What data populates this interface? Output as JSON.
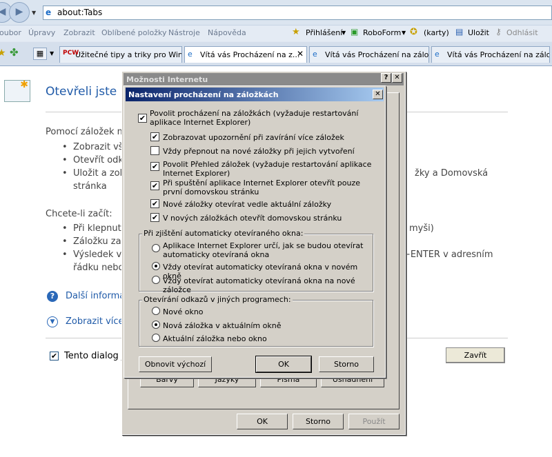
{
  "browser": {
    "address": "about:Tabs",
    "menu": [
      "oubor",
      "Úpravy",
      "Zobrazit",
      "Oblíbené položky",
      "Nástroje",
      "Nápověda"
    ],
    "toolbar": {
      "login": "Přihlášení",
      "roboform": "RoboForm",
      "cards": "(karty)",
      "save": "Uložit",
      "logout": "Odhlásit"
    },
    "tabs": [
      {
        "label": "Užitečné tipy a triky pro Win..."
      },
      {
        "label": "Vítá vás Procházení na z..."
      },
      {
        "label": "Vítá vás Procházení na zálož..."
      },
      {
        "label": "Vítá vás Procházení na zálož..."
      }
    ]
  },
  "page": {
    "heading": "Otevřeli jste n",
    "intro": "Pomocí záložek m",
    "bullets1": [
      "Zobrazit vš",
      "Otevřít odk",
      "Uložit a zob",
      "stránka"
    ],
    "bullets1_right": "žky a Domovská",
    "subheading": "Chcete-li začít:",
    "bullets2": [
      "Při klepnutí",
      "Záložku zav",
      "Výsledek vy",
      "řádku nebo"
    ],
    "bullets2_right_a": "myši)",
    "bullets2_right_b": "T+ENTER v adresním",
    "more_info": "Další informa",
    "show_more": "Zobrazit více",
    "dont_show": "Tento dialog j",
    "close_btn": "Zavřít"
  },
  "internet_options": {
    "title": "Možnosti Internetu",
    "buttons_row": [
      "Barvy",
      "Jazyky",
      "Písma",
      "Usnadnění"
    ],
    "ok": "OK",
    "cancel": "Storno",
    "apply": "Použít"
  },
  "tabbed_settings": {
    "title": "Nastavení procházení na záložkách",
    "enable": {
      "label": "Povolit procházení na záložkách (vyžaduje restartování aplikace Internet Explorer)",
      "checked": true
    },
    "options": [
      {
        "label": "Zobrazovat upozornění při zavírání více záložek",
        "checked": true
      },
      {
        "label": "Vždy přepnout na nové záložky při jejich vytvoření",
        "checked": false
      },
      {
        "label": "Povolit Přehled záložek (vyžaduje restartování aplikace Internet Explorer)",
        "checked": true
      },
      {
        "label": "Při spuštění aplikace Internet Explorer otevřít pouze první domovskou stránku",
        "checked": true
      },
      {
        "label": "Nové záložky otevírat vedle aktuální záložky",
        "checked": true
      },
      {
        "label": "V nových záložkách otevřít domovskou stránku",
        "checked": true
      }
    ],
    "popup_group": {
      "legend": "Při zjištění automaticky otevíraného okna:",
      "options": [
        {
          "label": "Aplikace Internet Explorer určí, jak se budou otevírat automaticky otevíraná okna",
          "selected": false
        },
        {
          "label": "Vždy otevírat automaticky otevíraná okna v novém okně",
          "selected": true
        },
        {
          "label": "Vždy otevírat automaticky otevíraná okna na nové záložce",
          "selected": false
        }
      ]
    },
    "links_group": {
      "legend": "Otevírání odkazů v jiných programech:",
      "options": [
        {
          "label": "Nové okno",
          "selected": false
        },
        {
          "label": "Nová záložka v aktuálním okně",
          "selected": true
        },
        {
          "label": "Aktuální záložka nebo okno",
          "selected": false
        }
      ]
    },
    "restore": "Obnovit výchozí",
    "ok": "OK",
    "cancel": "Storno"
  }
}
